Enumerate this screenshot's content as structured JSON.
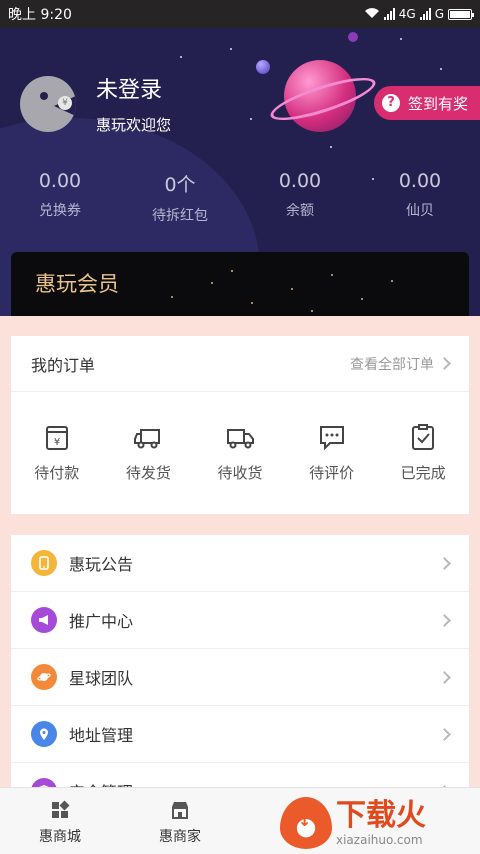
{
  "status_bar": {
    "time": "晚上 9:20",
    "network": "4G",
    "network2": "G"
  },
  "header": {
    "username": "未登录",
    "welcome": "惠玩欢迎您",
    "checkin_label": "签到有奖",
    "stats": [
      {
        "value": "0.00",
        "label": "兑换券"
      },
      {
        "value": "0个",
        "label": "待拆红包"
      },
      {
        "value": "0.00",
        "label": "余额"
      },
      {
        "value": "0.00",
        "label": "仙贝"
      }
    ],
    "vip_title": "惠玩会员"
  },
  "orders": {
    "title": "我的订单",
    "view_all": "查看全部订单",
    "items": [
      {
        "label": "待付款",
        "icon": "wallet-yen-icon"
      },
      {
        "label": "待发货",
        "icon": "truck-icon"
      },
      {
        "label": "待收货",
        "icon": "delivery-truck-icon"
      },
      {
        "label": "待评价",
        "icon": "comment-icon"
      },
      {
        "label": "已完成",
        "icon": "clipboard-check-icon"
      }
    ]
  },
  "menu": {
    "items": [
      {
        "label": "惠玩公告",
        "icon": "announcement-icon",
        "color": "#f5b53a"
      },
      {
        "label": "推广中心",
        "icon": "megaphone-icon",
        "color": "#a64ad8"
      },
      {
        "label": "星球团队",
        "icon": "planet-icon",
        "color": "#f28a3a"
      },
      {
        "label": "地址管理",
        "icon": "location-icon",
        "color": "#4a86e8"
      },
      {
        "label": "安全管理",
        "icon": "shield-icon",
        "color": "#a64ad8"
      }
    ]
  },
  "tabbar": {
    "items": [
      {
        "label": "惠商城",
        "icon": "grid-icon"
      },
      {
        "label": "惠商家",
        "icon": "store-icon"
      }
    ]
  },
  "watermark": {
    "title": "下载火",
    "url": "xiazaihuo.com"
  }
}
